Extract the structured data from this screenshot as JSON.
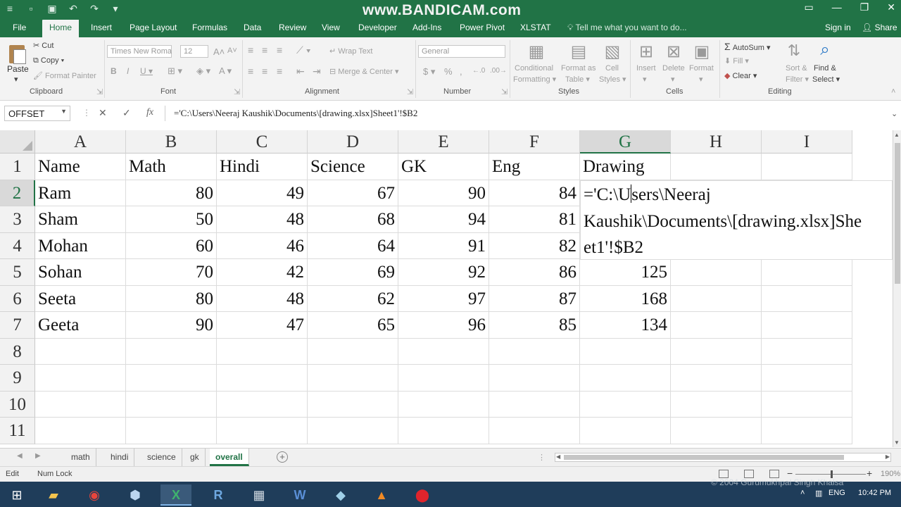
{
  "watermark": "www.BANDICAM.com",
  "tabs": [
    "File",
    "Home",
    "Insert",
    "Page Layout",
    "Formulas",
    "Data",
    "Review",
    "View",
    "Developer",
    "Add-Ins",
    "Power Pivot",
    "XLSTAT"
  ],
  "tell_me": "Tell me what you want to do...",
  "sign_in": "Sign in",
  "share": "Share",
  "ribbon": {
    "clipboard": {
      "label": "Clipboard",
      "paste": "Paste",
      "cut": "Cut",
      "copy": "Copy",
      "format_painter": "Format Painter"
    },
    "font": {
      "label": "Font",
      "name": "Times New Roma",
      "size": "12"
    },
    "alignment": {
      "label": "Alignment",
      "wrap_text": "Wrap Text",
      "merge_center": "Merge & Center"
    },
    "number": {
      "label": "Number",
      "format": "General"
    },
    "styles": {
      "label": "Styles",
      "conditional": "Conditional",
      "formatting": "Formatting",
      "format_as": "Format as",
      "table": "Table",
      "cell": "Cell",
      "styles": "Styles"
    },
    "cells": {
      "label": "Cells",
      "insert": "Insert",
      "delete": "Delete",
      "format": "Format"
    },
    "editing": {
      "label": "Editing",
      "autosum": "AutoSum",
      "fill": "Fill",
      "clear": "Clear",
      "sort_filter_1": "Sort &",
      "sort_filter_2": "Filter",
      "find_select_1": "Find &",
      "find_select_2": "Select"
    }
  },
  "formula_bar": {
    "name_box": "OFFSET",
    "formula": "='C:\\Users\\Neeraj Kaushik\\Documents\\[drawing.xlsx]Sheet1'!$B2"
  },
  "grid": {
    "columns": [
      "A",
      "B",
      "C",
      "D",
      "E",
      "F",
      "G",
      "H",
      "I"
    ],
    "rows": [
      "1",
      "2",
      "3",
      "4",
      "5",
      "6",
      "7",
      "8",
      "9",
      "10",
      "11"
    ],
    "header": [
      "Name",
      "Math",
      "Hindi",
      "Science",
      "GK",
      "Eng",
      "Drawing"
    ],
    "data": [
      [
        "Ram",
        "80",
        "49",
        "67",
        "90",
        "84",
        ""
      ],
      [
        "Sham",
        "50",
        "48",
        "68",
        "94",
        "81",
        ""
      ],
      [
        "Mohan",
        "60",
        "46",
        "64",
        "91",
        "82",
        ""
      ],
      [
        "Sohan",
        "70",
        "42",
        "69",
        "92",
        "86",
        "125"
      ],
      [
        "Seeta",
        "80",
        "48",
        "62",
        "97",
        "87",
        "168"
      ],
      [
        "Geeta",
        "90",
        "47",
        "65",
        "96",
        "85",
        "134"
      ]
    ],
    "edit_lines": [
      "='C:\\U",
      "sers\\Neeraj",
      "Kaushik\\Documents\\[drawing.xlsx]She",
      "et1'!$B2"
    ]
  },
  "sheets": [
    "math",
    "hindi",
    "science",
    "gk",
    "overall"
  ],
  "active_sheet": "overall",
  "status": {
    "mode": "Edit",
    "num_lock": "Num Lock",
    "zoom": "190%"
  },
  "taskbar": {
    "lang": "ENG",
    "time": "10:42 PM"
  },
  "copyright": "© 2004 Gurumukhpal Singh Khalsa"
}
